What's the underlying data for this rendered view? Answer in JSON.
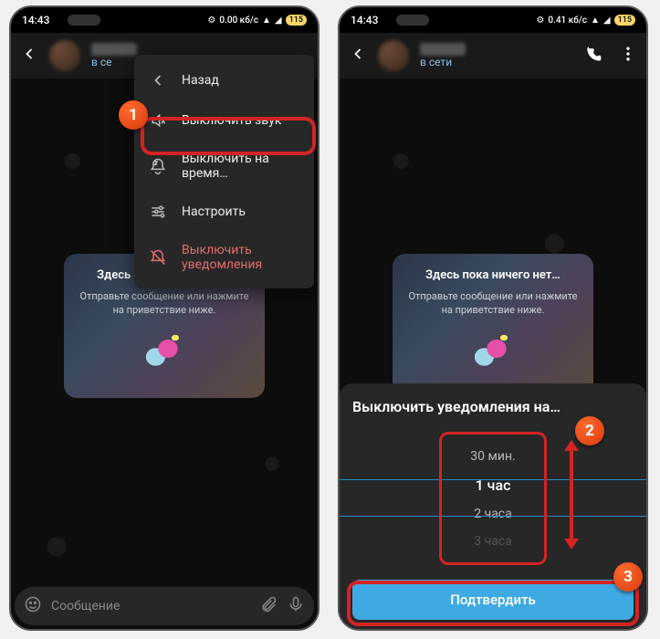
{
  "status": {
    "time": "14:43",
    "bt": "✱",
    "net": "0.00 кб/с",
    "net2": "0.41 кб/с",
    "wifi": "📶",
    "sig": "📶",
    "batt": "115"
  },
  "header": {
    "back_aria": "Назад",
    "online": "в сети",
    "online_short": "в се"
  },
  "menu": {
    "back": "Назад",
    "mute": "Выключить звук",
    "mute_time": "Выключить на время…",
    "configure": "Настроить",
    "disable": "Выключить уведомления"
  },
  "empty": {
    "title": "Здесь пока ничего нет…",
    "subtitle": "Отправьте сообщение или нажмите на приветствие ниже."
  },
  "compose": {
    "placeholder": "Сообщение"
  },
  "sheet": {
    "title": "Выключить уведомления на…",
    "options": [
      "30 мин.",
      "1 час",
      "2 часа",
      "3 часа"
    ],
    "confirm": "Подтвердить"
  },
  "markers": {
    "one": "1",
    "two": "2",
    "three": "3"
  }
}
